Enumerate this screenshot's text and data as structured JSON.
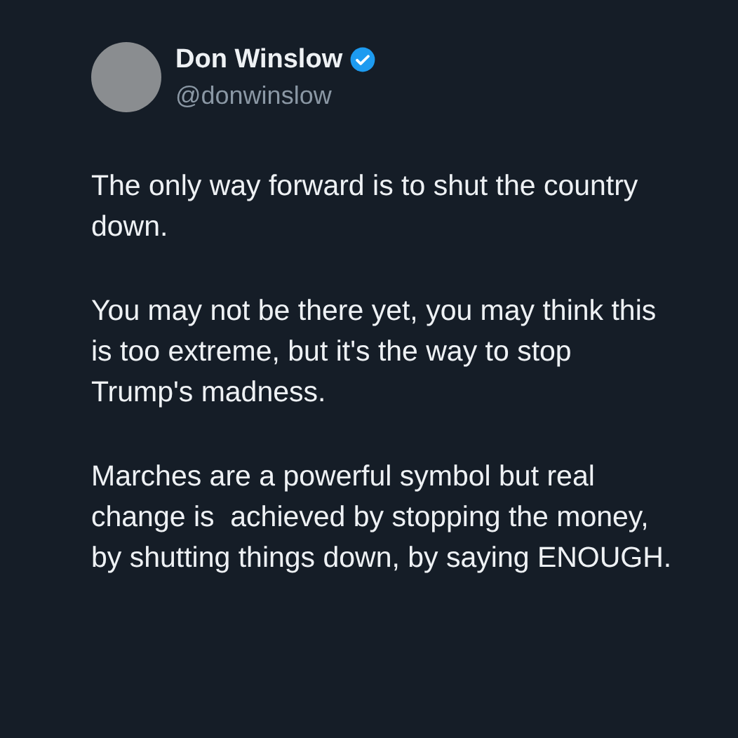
{
  "author": {
    "name": "Don Winslow",
    "verified": true,
    "handle": "@donwinslow"
  },
  "paragraphs": [
    "The only way forward is to shut the country down.",
    "You may not be there yet, you may think this is too extreme, but it's the way to stop Trump's madness.",
    "Marches are a powerful symbol but real change is  achieved by stopping the money, by shutting things down, by saying ENOUGH."
  ]
}
